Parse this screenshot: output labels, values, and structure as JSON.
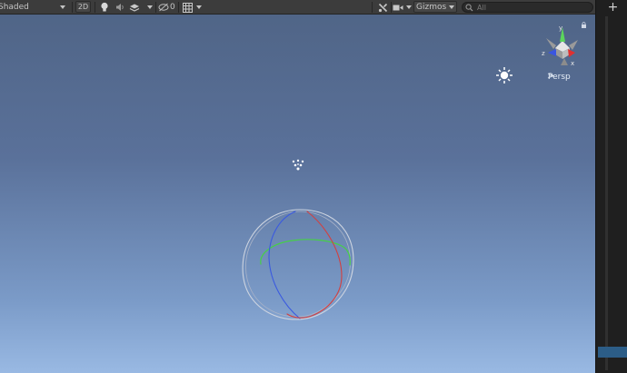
{
  "toolbar": {
    "shading_mode": "Shaded",
    "mode_2d": "2D",
    "hidden_count": "0",
    "gizmos_label": "Gizmos",
    "search_placeholder": "All",
    "icons": [
      "dropdown-arrow",
      "lightbulb-icon",
      "audio-icon",
      "effects-layers-icon",
      "hidden-objects-icon",
      "grid-icon",
      "tools-icon",
      "camera-icon"
    ]
  },
  "scene": {
    "gizmo_axes": [
      "y",
      "z",
      "x"
    ],
    "view_mode_label": "Persp",
    "objects": [
      "directional-light-icon",
      "particle-system-icon",
      "sphere-collider-gizmo"
    ]
  },
  "right_panel": {
    "add_label": "+"
  },
  "colors": {
    "axis_x": "#d03030",
    "axis_y": "#50d050",
    "axis_z": "#3050e0",
    "collider": "#d8dde8"
  }
}
